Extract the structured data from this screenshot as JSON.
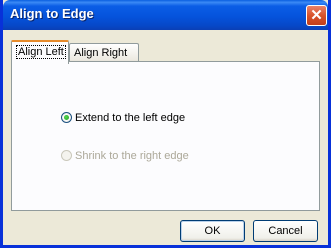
{
  "window": {
    "title": "Align to Edge",
    "close_icon": "close-icon"
  },
  "tabs": [
    {
      "label": "Align Left",
      "active": true
    },
    {
      "label": "Align Right",
      "active": false
    }
  ],
  "options": [
    {
      "label": "Extend to the left edge",
      "selected": true,
      "enabled": true
    },
    {
      "label": "Shrink to the right edge",
      "selected": false,
      "enabled": false
    }
  ],
  "buttons": {
    "ok": "OK",
    "cancel": "Cancel"
  },
  "colors": {
    "titlebar": "#0553dc",
    "close_button": "#d9532b",
    "tab_highlight": "#e68b2c",
    "radio_selected": "#21a121",
    "disabled_text": "#aca899"
  }
}
